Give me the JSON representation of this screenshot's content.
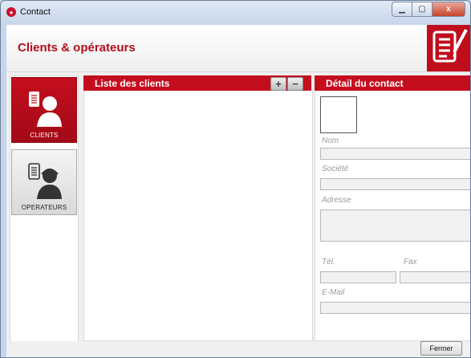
{
  "window": {
    "title": "Contact",
    "icon": "app-logo-icon",
    "controls": [
      "minimize-icon",
      "maximize-icon",
      "close-icon"
    ],
    "close_glyph": "x"
  },
  "header": {
    "title": "Clients & opérateurs",
    "icon": "contact-edit-icon",
    "accent_color": "#c40e1e"
  },
  "sidebar": {
    "items": [
      {
        "label": "CLIENTS",
        "icon": "client-person-icon",
        "active": true
      },
      {
        "label": "OPERATEURS",
        "icon": "operator-person-icon",
        "active": false
      }
    ]
  },
  "client_list": {
    "title": "Liste des clients",
    "add_icon": "plus-icon",
    "remove_icon": "minus-icon",
    "add_glyph": "+",
    "remove_glyph": "−"
  },
  "contact_detail": {
    "title": "Détail du contact",
    "fields": {
      "nom": {
        "label": "Nom",
        "value": ""
      },
      "societe": {
        "label": "Société",
        "value": ""
      },
      "adresse": {
        "label": "Adresse",
        "value": ""
      },
      "tel": {
        "label": "Tél.",
        "value": ""
      },
      "fax": {
        "label": "Fax",
        "value": ""
      },
      "email": {
        "label": "E-Mail",
        "value": ""
      }
    }
  },
  "footer": {
    "close_label": "Fermer"
  }
}
